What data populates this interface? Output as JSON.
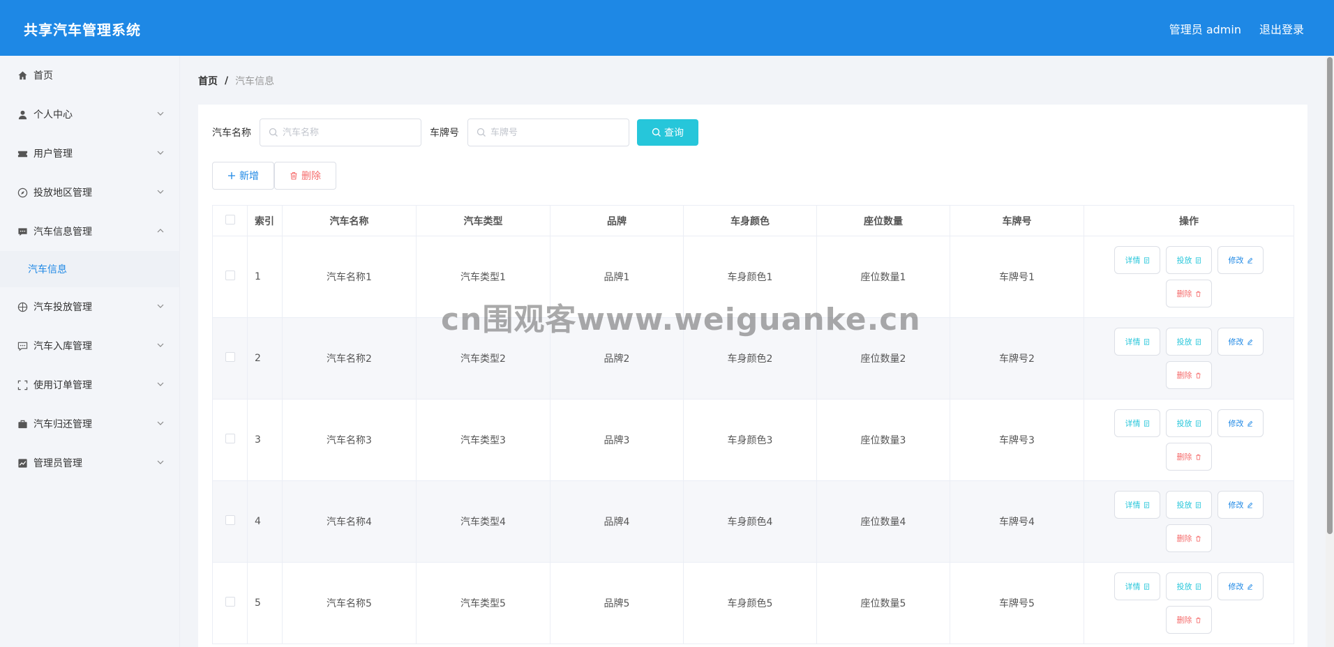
{
  "header": {
    "title": "共享汽车管理系统",
    "user_label": "管理员 admin",
    "logout_label": "退出登录",
    "bg_color": "#1e88e5"
  },
  "sidebar": {
    "items": [
      {
        "label": "首页",
        "icon": "home-icon"
      },
      {
        "label": "个人中心",
        "icon": "user-icon",
        "expandable": true
      },
      {
        "label": "用户管理",
        "icon": "ticket-icon",
        "expandable": true
      },
      {
        "label": "投放地区管理",
        "icon": "compass-icon",
        "expandable": true
      },
      {
        "label": "汽车信息管理",
        "icon": "chat-icon",
        "expandable": true,
        "expanded": true,
        "children": [
          "汽车信息"
        ]
      },
      {
        "label": "汽车投放管理",
        "icon": "globe-icon",
        "expandable": true
      },
      {
        "label": "汽车入库管理",
        "icon": "chat-dots-icon",
        "expandable": true
      },
      {
        "label": "使用订单管理",
        "icon": "fullscreen-icon",
        "expandable": true
      },
      {
        "label": "汽车归还管理",
        "icon": "briefcase-icon",
        "expandable": true
      },
      {
        "label": "管理员管理",
        "icon": "chart-icon",
        "expandable": true
      }
    ],
    "active_sub": "汽车信息"
  },
  "breadcrumb": {
    "home": "首页",
    "separator": "/",
    "current": "汽车信息"
  },
  "search": {
    "name_label": "汽车名称",
    "name_placeholder": "汽车名称",
    "plate_label": "车牌号",
    "plate_placeholder": "车牌号",
    "query_label": "查询"
  },
  "actions": {
    "add_label": "新增",
    "delete_label": "删除"
  },
  "table": {
    "headers": [
      "索引",
      "汽车名称",
      "汽车类型",
      "品牌",
      "车身颜色",
      "座位数量",
      "车牌号",
      "操作"
    ],
    "rows": [
      {
        "idx": "1",
        "name": "汽车名称1",
        "type": "汽车类型1",
        "brand": "品牌1",
        "color": "车身颜色1",
        "seats": "座位数量1",
        "plate": "车牌号1"
      },
      {
        "idx": "2",
        "name": "汽车名称2",
        "type": "汽车类型2",
        "brand": "品牌2",
        "color": "车身颜色2",
        "seats": "座位数量2",
        "plate": "车牌号2"
      },
      {
        "idx": "3",
        "name": "汽车名称3",
        "type": "汽车类型3",
        "brand": "品牌3",
        "color": "车身颜色3",
        "seats": "座位数量3",
        "plate": "车牌号3"
      },
      {
        "idx": "4",
        "name": "汽车名称4",
        "type": "汽车类型4",
        "brand": "品牌4",
        "color": "车身颜色4",
        "seats": "座位数量4",
        "plate": "车牌号4"
      },
      {
        "idx": "5",
        "name": "汽车名称5",
        "type": "汽车类型5",
        "brand": "品牌5",
        "color": "车身颜色5",
        "seats": "座位数量5",
        "plate": "车牌号5"
      }
    ],
    "op_labels": {
      "detail": "详情",
      "deploy": "投放",
      "edit": "修改",
      "delete": "删除"
    }
  },
  "watermark": "cn围观客www.weiguanke.cn",
  "colors": {
    "accent": "#1e88e5",
    "query_btn": "#26c6da",
    "danger": "#f56c6c"
  }
}
